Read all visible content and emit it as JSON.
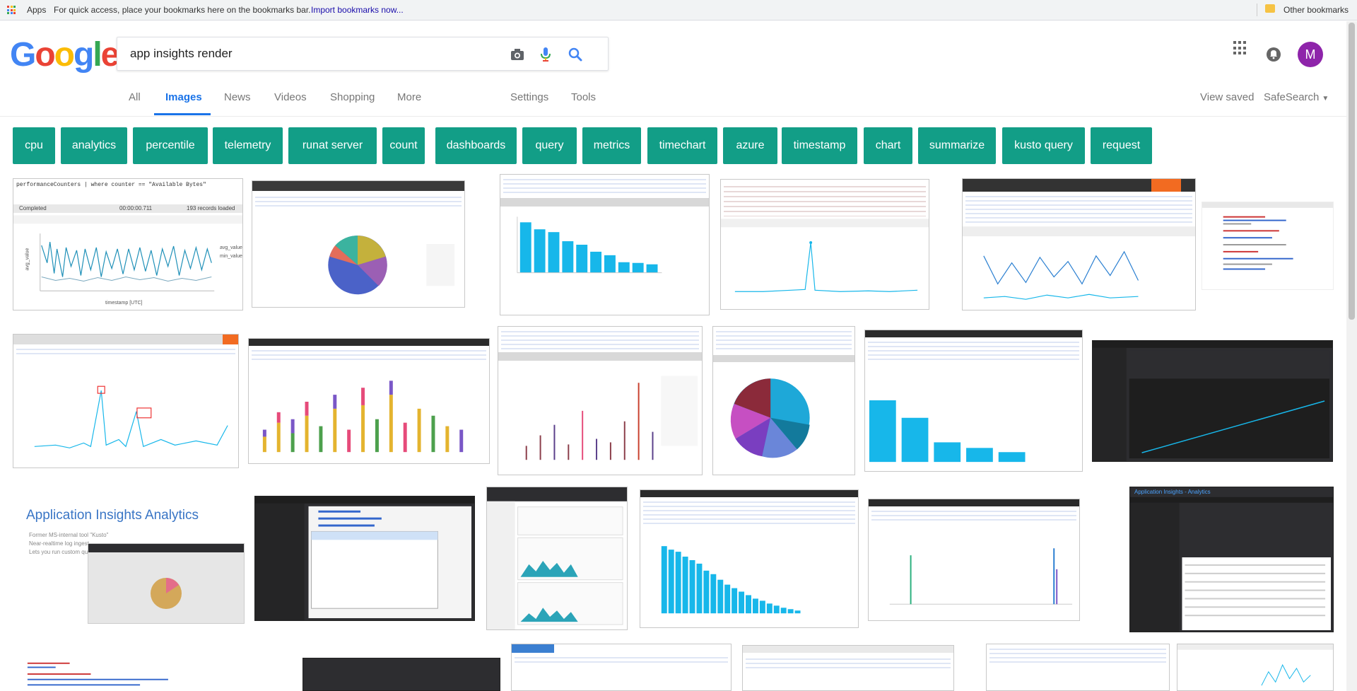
{
  "bookmarks": {
    "apps_label": "Apps",
    "hint_text": "For quick access, place your bookmarks here on the bookmarks bar.",
    "import_link": "Import bookmarks now...",
    "other_bookmarks": "Other bookmarks"
  },
  "brand": {
    "logo_letters": [
      "G",
      "o",
      "o",
      "g",
      "l",
      "e"
    ],
    "logo_colors": [
      "#4285f4",
      "#ea4335",
      "#fbbc05",
      "#4285f4",
      "#34a853",
      "#ea4335"
    ]
  },
  "search": {
    "query": "app insights render",
    "icons": [
      "camera-icon",
      "microphone-icon",
      "search-icon"
    ]
  },
  "account": {
    "avatar_letter": "M",
    "avatar_color": "#8e24aa"
  },
  "tabs": {
    "items": [
      "All",
      "Images",
      "News",
      "Videos",
      "Shopping",
      "More"
    ],
    "active": "Images",
    "settings": "Settings",
    "tools": "Tools",
    "view_saved": "View saved",
    "safesearch": "SafeSearch"
  },
  "chips": {
    "items": [
      "cpu",
      "analytics",
      "percentile",
      "telemetry",
      "runat server",
      "count",
      "dashboards",
      "query",
      "metrics",
      "timechart",
      "azure",
      "timestamp",
      "chart",
      "summarize",
      "kusto query",
      "request"
    ],
    "color": "#129e87"
  },
  "results": {
    "text_snippets": {
      "r1_query": "performanceCounters | where counter == \"Available Bytes\"",
      "r1_status": "Completed",
      "r1_time": "00:00:00.711",
      "r1_records": "193 records loaded",
      "r1_ylabel": "avg_value",
      "r1_xlabel": "timestamp [UTC]",
      "r1_legend_a": "avg_value",
      "r1_legend_b": "min_value",
      "r5_chart": "Line Chart",
      "r9_title": "Application Insights Analytics",
      "r9_note_1": "Former MS-internal tool \"Kusto\"",
      "r9_note_2": "Near-realtime log ingest",
      "r9_note_3": "Lets you run custom queries",
      "r15_title": "Application Insights - Analytics"
    }
  }
}
